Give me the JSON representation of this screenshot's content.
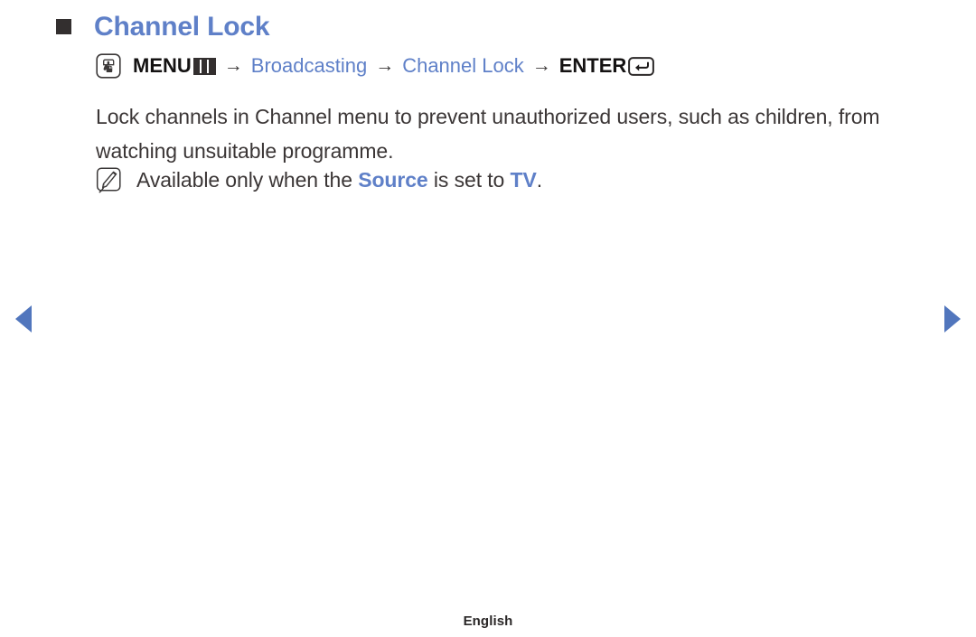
{
  "heading": {
    "bullet_icon": "filled-square-bullet-icon",
    "title": "Channel Lock"
  },
  "path": {
    "hand_icon": "menu-hand-press-icon",
    "menu_label": "MENU",
    "menu_bars_icon": "menu-bars-icon",
    "arrow1": "→",
    "step_broadcasting": "Broadcasting",
    "arrow2": "→",
    "step_channel_lock": "Channel Lock",
    "arrow3": "→",
    "enter_label": "ENTER",
    "enter_icon": "enter-return-key-icon"
  },
  "body": {
    "paragraph": "Lock channels in Channel menu to prevent unauthorized users, such as children, from watching unsuitable programme."
  },
  "note": {
    "note_icon": "note-pencil-icon",
    "text_before": "Available only when the ",
    "highlight_source": "Source",
    "text_middle": " is set to ",
    "highlight_tv": "TV",
    "text_after": "."
  },
  "navigation": {
    "prev_icon": "previous-page-arrow-icon",
    "next_icon": "next-page-arrow-icon"
  },
  "footer": {
    "language": "English"
  },
  "colors": {
    "accent_blue": "#5f80c8",
    "nav_blue": "#5176bd",
    "bullet_dark": "#332f2f",
    "body_text": "#3b3636",
    "background": "#ffffff"
  }
}
